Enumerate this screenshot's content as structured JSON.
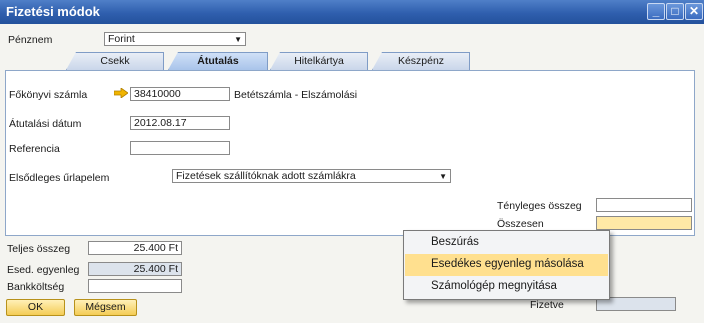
{
  "window": {
    "title": "Fizetési módok",
    "min_icon": "minimize-icon",
    "max_icon": "maximize-icon",
    "close_icon": "close-icon"
  },
  "currency": {
    "label": "Pénznem",
    "value": "Forint"
  },
  "tabs": [
    {
      "label": "Csekk",
      "active": false
    },
    {
      "label": "Átutalás",
      "active": true
    },
    {
      "label": "Hitelkártya",
      "active": false
    },
    {
      "label": "Készpénz",
      "active": false
    }
  ],
  "transfer": {
    "gl_account_label": "Főkönyvi számla",
    "gl_account_value": "38410000",
    "gl_account_name": "Betétszámla - Elszámolási",
    "date_label": "Átutalási dátum",
    "date_value": "2012.08.17",
    "reference_label": "Referencia",
    "reference_value": "",
    "form_label": "Elsődleges űrlapelem",
    "form_value": "Fizetések szállítóknak adott számlákra",
    "actual_amount_label": "Tényleges összeg",
    "actual_amount_value": "",
    "total_label": "Összesen",
    "total_value": ""
  },
  "summary": {
    "total_label": "Teljes összeg",
    "total_value": "25.400 Ft",
    "balance_label": "Esed. egyenleg",
    "balance_value": "25.400 Ft",
    "bank_fee_label": "Bankköltség",
    "bank_fee_value": "",
    "paid_label": "Fizetve",
    "paid_value": ""
  },
  "buttons": {
    "ok": "OK",
    "cancel": "Mégsem"
  },
  "context_menu": {
    "items": [
      {
        "label": "Beszúrás",
        "highlighted": false
      },
      {
        "label": "Esedékes egyenleg másolása",
        "highlighted": true
      },
      {
        "label": "Számológép megnyitása",
        "highlighted": false
      }
    ]
  },
  "colors": {
    "title_bar": "#2f5fae",
    "highlight": "#ffe08f",
    "button": "#f4cc55",
    "link_arrow": "#f0b400"
  }
}
